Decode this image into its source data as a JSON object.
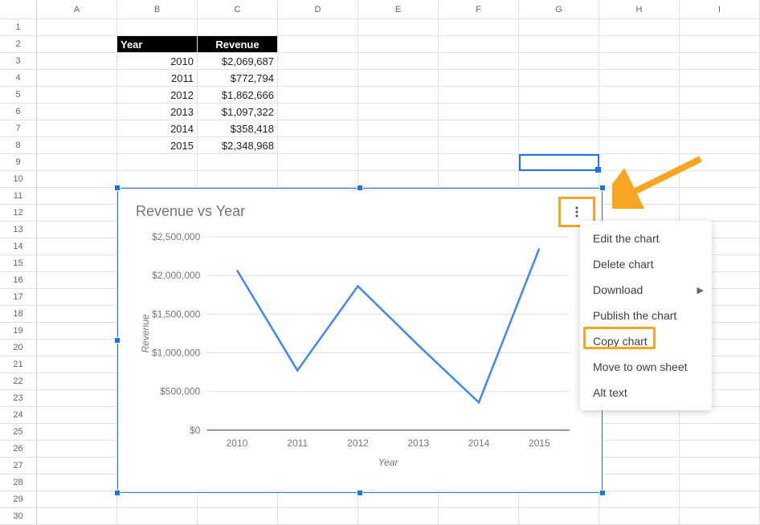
{
  "columns": [
    "A",
    "B",
    "C",
    "D",
    "E",
    "F",
    "G",
    "H",
    "I"
  ],
  "row_count": 30,
  "table": {
    "header": {
      "b": "Year",
      "c": "Revenue"
    },
    "rows": [
      {
        "year": "2010",
        "revenue": "$2,069,687"
      },
      {
        "year": "2011",
        "revenue": "$772,794"
      },
      {
        "year": "2012",
        "revenue": "$1,862,666"
      },
      {
        "year": "2013",
        "revenue": "$1,097,322"
      },
      {
        "year": "2014",
        "revenue": "$358,418"
      },
      {
        "year": "2015",
        "revenue": "$2,348,968"
      }
    ]
  },
  "active_cell": "G9",
  "chart_data": {
    "type": "line",
    "title": "Revenue vs Year",
    "xlabel": "Year",
    "ylabel": "Revenue",
    "categories": [
      "2010",
      "2011",
      "2012",
      "2013",
      "2014",
      "2015"
    ],
    "values": [
      2069687,
      772794,
      1862666,
      1097322,
      358418,
      2348968
    ],
    "ylim": [
      0,
      2500000
    ],
    "y_ticks": [
      "$0",
      "$500,000",
      "$1,000,000",
      "$1,500,000",
      "$2,000,000",
      "$2,500,000"
    ]
  },
  "context_menu": {
    "items": [
      {
        "label": "Edit the chart",
        "has_sub": false
      },
      {
        "label": "Delete chart",
        "has_sub": false
      },
      {
        "label": "Download",
        "has_sub": true
      },
      {
        "label": "Publish the chart",
        "has_sub": false
      },
      {
        "label": "Copy chart",
        "has_sub": false
      },
      {
        "label": "Move to own sheet",
        "has_sub": false
      },
      {
        "label": "Alt text",
        "has_sub": false
      }
    ],
    "highlighted": "Copy chart"
  }
}
